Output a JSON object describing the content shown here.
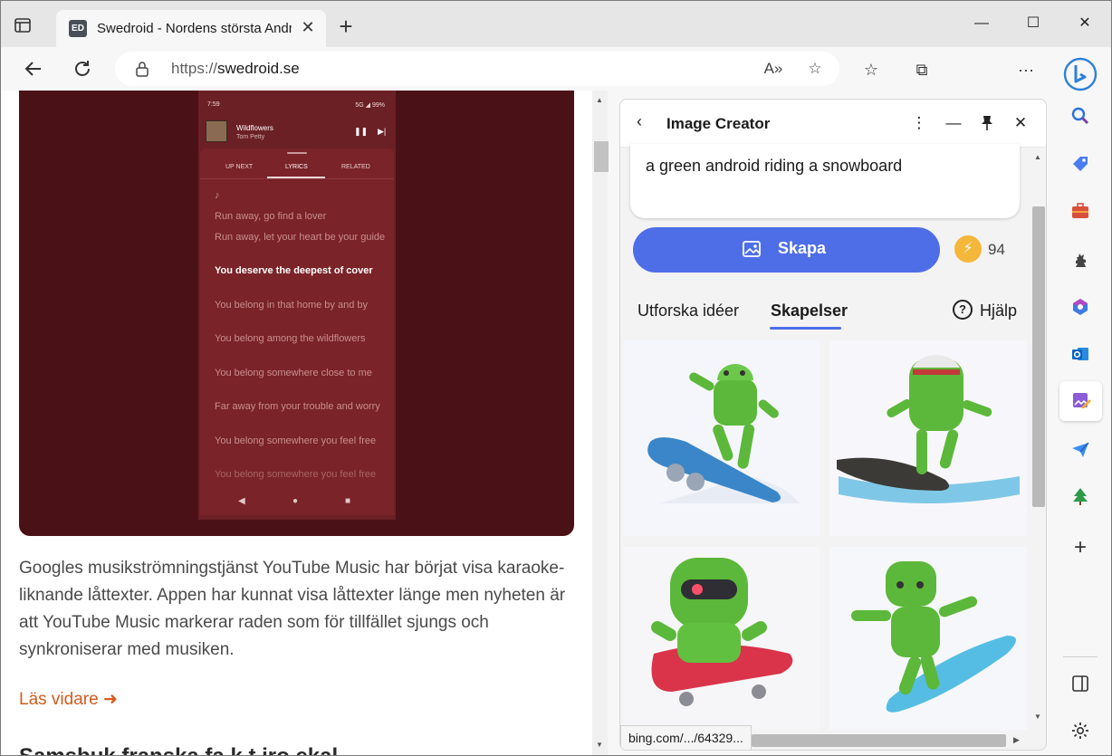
{
  "browser": {
    "tab_title": "Swedroid - Nordens största Andr",
    "favicon_text": "ED",
    "url_protocol": "https://",
    "url_domain": "swedroid.se"
  },
  "page": {
    "phone": {
      "time": "7:59",
      "status_right": "5G ◢ 99%",
      "song": "Wildflowers",
      "artist": "Tom Petty",
      "tabs": [
        "UP NEXT",
        "LYRICS",
        "RELATED"
      ],
      "note_glyph": "♪",
      "lyrics": [
        "Run away, go find a lover",
        "Run away, let your heart be your guide",
        "You deserve the deepest of cover",
        "You belong in that home by and by",
        "You belong among the wildflowers",
        "You belong somewhere close to me",
        "Far away from your trouble and worry",
        "You belong somewhere you feel free",
        "You belong somewhere you feel free"
      ],
      "active_lyric_index": 2
    },
    "article_text": "Googles musikströmningstjänst YouTube Music har börjat visa karaoke-liknande låttexter. Appen har kunnat visa låttexter länge men nyheten är att YouTube Music markerar raden som för tillfället sjungs och synkroniserar med musiken.",
    "read_more": "Läs vidare",
    "next_heading": "Samsbuk franska fa k t iro ekal"
  },
  "panel": {
    "title": "Image Creator",
    "prompt": "a green android riding a snowboard",
    "create_label": "Skapa",
    "boosts": "94",
    "tabs": [
      "Utforska idéer",
      "Skapelser"
    ],
    "selected_tab": "Skapelser",
    "help_label": "Hjälp",
    "status_url": "bing.com/.../64329..."
  },
  "colors": {
    "accent": "#4e6ee8",
    "hero_bg": "#4a1216",
    "link": "#d35a1e"
  }
}
